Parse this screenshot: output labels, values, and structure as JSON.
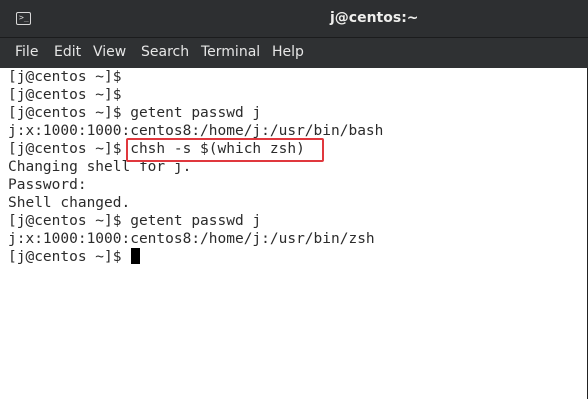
{
  "titlebar": {
    "icon": "terminal-icon",
    "title": "j@centos:~"
  },
  "menubar": {
    "items": [
      {
        "label": "File"
      },
      {
        "label": "Edit"
      },
      {
        "label": "View"
      },
      {
        "label": "Search"
      },
      {
        "label": "Terminal"
      },
      {
        "label": "Help"
      }
    ]
  },
  "terminal": {
    "lines": [
      "[j@centos ~]$",
      "[j@centos ~]$",
      "[j@centos ~]$ getent passwd j",
      "j:x:1000:1000:centos8:/home/j:/usr/bin/bash",
      "[j@centos ~]$ chsh -s $(which zsh)",
      "Changing shell for j.",
      "Password:",
      "Shell changed.",
      "[j@centos ~]$ getent passwd j",
      "j:x:1000:1000:centos8:/home/j:/usr/bin/zsh",
      "[j@centos ~]$"
    ],
    "highlighted_command": "chsh -s $(which zsh)",
    "highlight_color": "#e0383e"
  },
  "colors": {
    "titlebar_bg": "#2d2f31",
    "menubar_bg": "#2f3133",
    "terminal_bg": "#ffffff",
    "terminal_fg": "#2b2b2b"
  }
}
